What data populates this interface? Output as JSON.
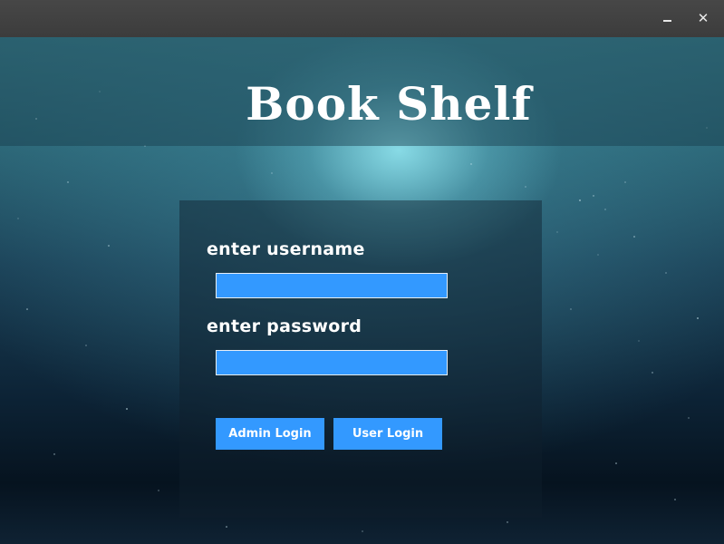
{
  "window": {
    "minimize_icon": "minimize-icon",
    "close_icon": "close-icon"
  },
  "app": {
    "title": "Book Shelf"
  },
  "login": {
    "username_label": "enter username",
    "username_value": "",
    "password_label": "enter password",
    "password_value": "",
    "admin_button": "Admin Login",
    "user_button": "User Login"
  },
  "colors": {
    "titlebar": "#404040",
    "field_bg": "#3399ff",
    "button_bg": "#3399ff",
    "text": "#ffffff"
  }
}
